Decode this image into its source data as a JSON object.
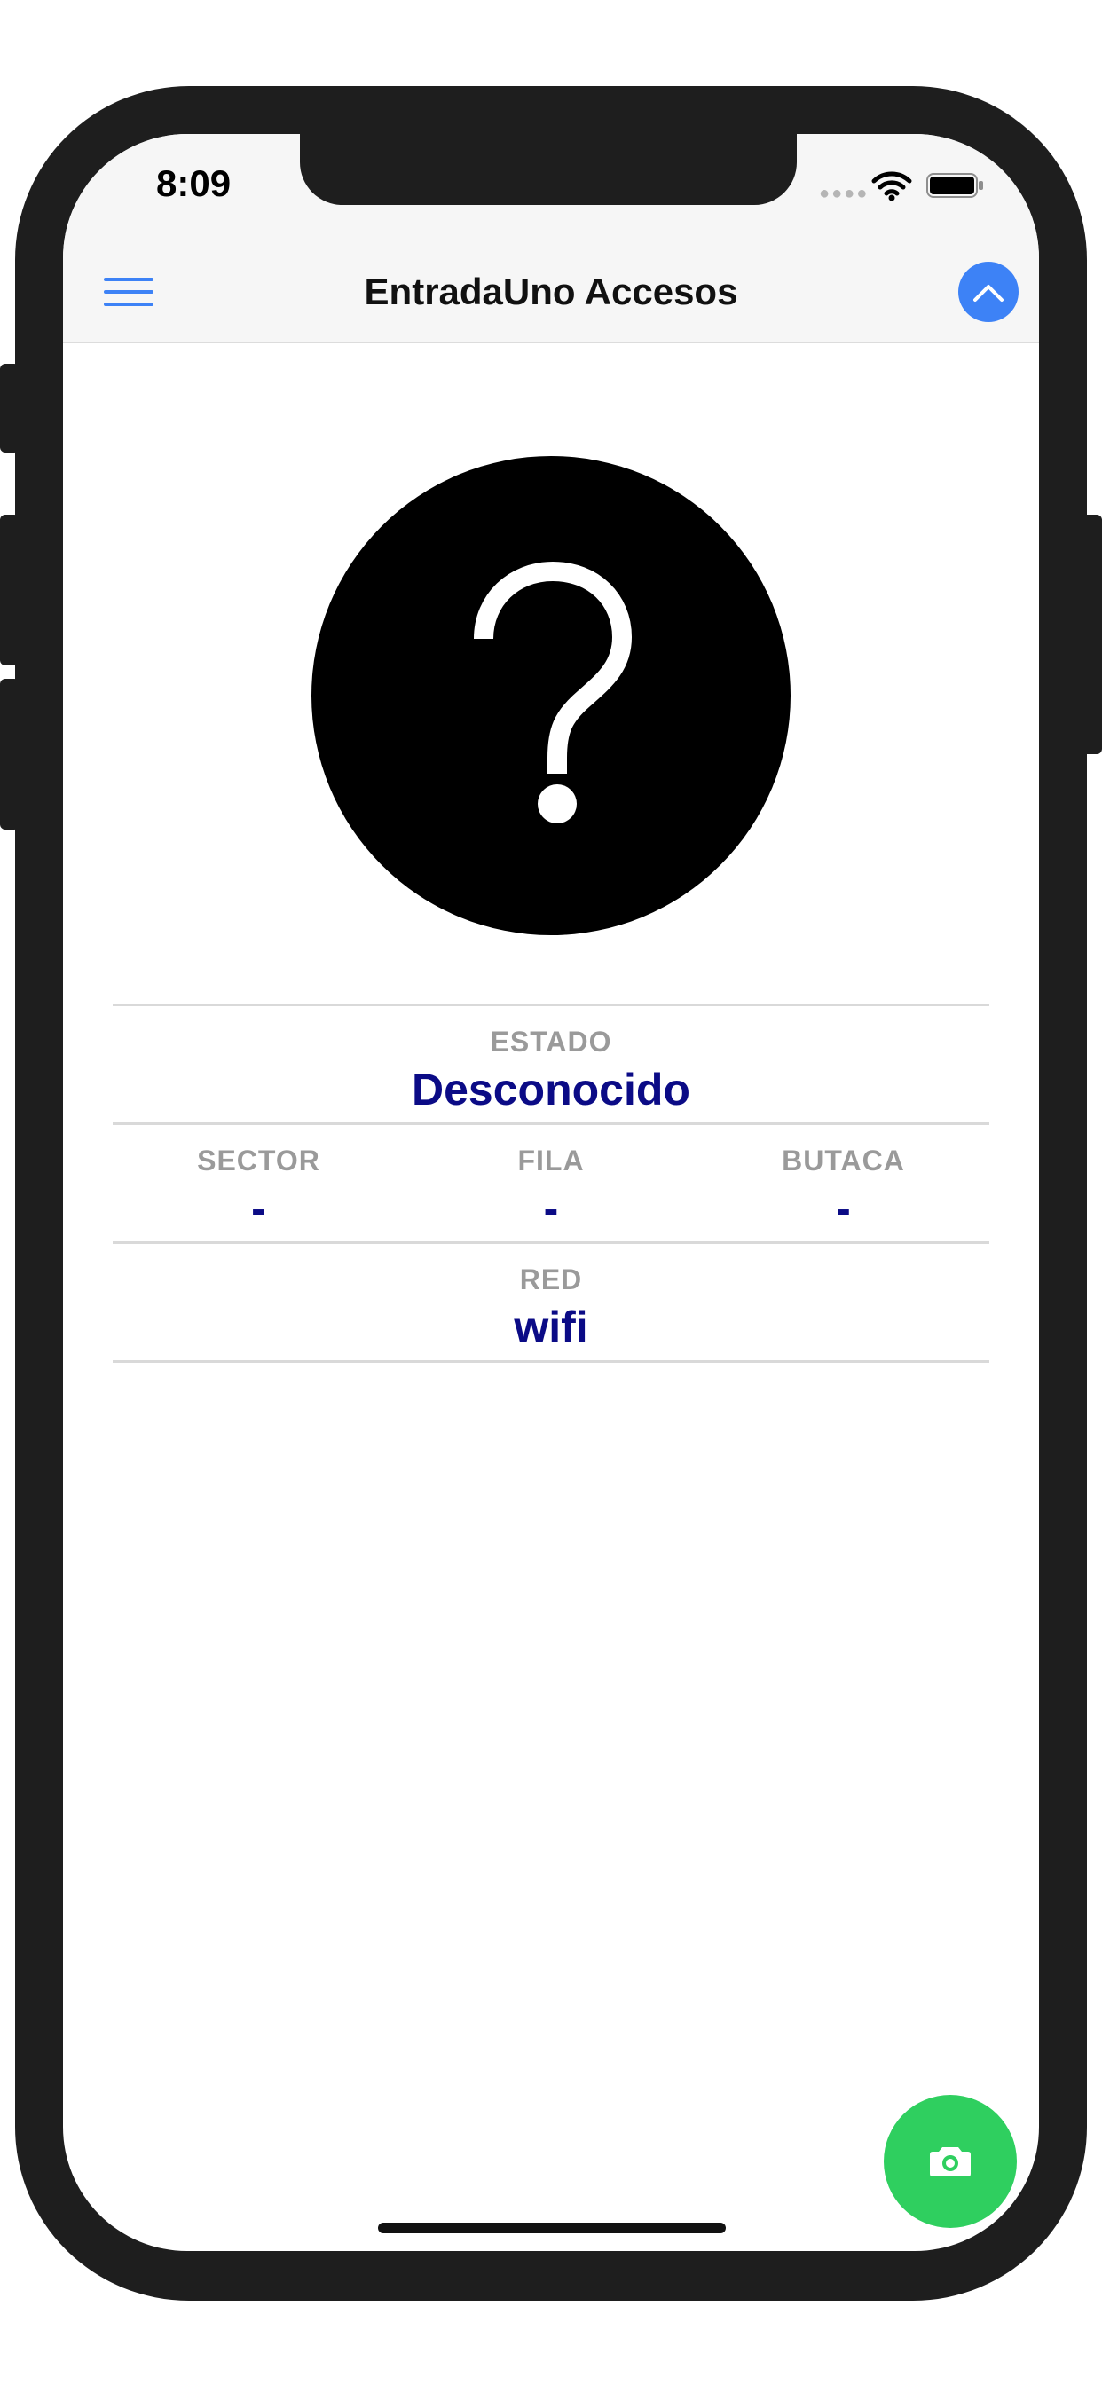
{
  "status_bar": {
    "time": "8:09",
    "signal_icon": "signal-dots-icon",
    "wifi_icon": "wifi-icon",
    "battery_icon": "battery-icon"
  },
  "nav": {
    "title": "EntradaUno Accesos",
    "menu_icon": "hamburger-menu-icon",
    "action_icon": "chevron-up-icon"
  },
  "status_indicator": {
    "icon": "question-mark-icon",
    "color": "#000000"
  },
  "info": {
    "estado": {
      "label": "ESTADO",
      "value": "Desconocido"
    },
    "sector": {
      "label": "SECTOR",
      "value": "-"
    },
    "fila": {
      "label": "FILA",
      "value": "-"
    },
    "butaca": {
      "label": "BUTACA",
      "value": "-"
    },
    "red": {
      "label": "RED",
      "value": "wifi"
    }
  },
  "fab": {
    "icon": "camera-icon",
    "color": "#2fcf5f"
  },
  "colors": {
    "accent": "#3d82f6",
    "value_text": "#0b0b86",
    "label_text": "#9a9a9a"
  }
}
